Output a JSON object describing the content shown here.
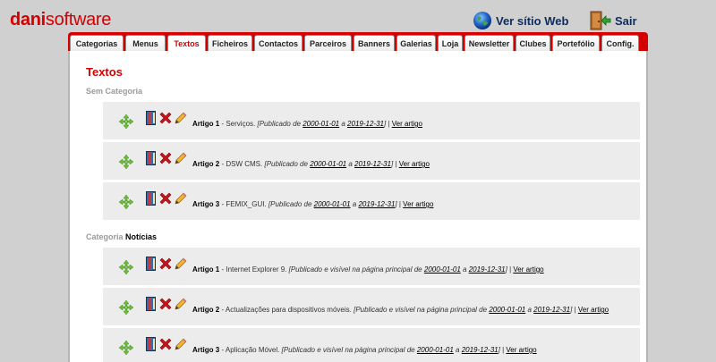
{
  "brand": {
    "part1": "dani",
    "part2": "software"
  },
  "header": {
    "web_label": "Ver sítio Web",
    "exit_label": "Sair"
  },
  "tabs": [
    {
      "label": "Categorias",
      "w": 60,
      "active": false
    },
    {
      "label": "Menus",
      "w": 45,
      "active": false
    },
    {
      "label": "Textos",
      "w": 43,
      "active": true
    },
    {
      "label": "Ficheiros",
      "w": 50,
      "active": false
    },
    {
      "label": "Contactos",
      "w": 54,
      "active": false
    },
    {
      "label": "Parceiros",
      "w": 53,
      "active": false
    },
    {
      "label": "Banners",
      "w": 46,
      "active": false
    },
    {
      "label": "Galerias",
      "w": 44,
      "active": false
    },
    {
      "label": "Loja",
      "w": 28,
      "active": false
    },
    {
      "label": "Newsletter",
      "w": 55,
      "active": false
    },
    {
      "label": "Clubes",
      "w": 39,
      "active": false
    },
    {
      "label": "Portefólio",
      "w": 53,
      "active": false
    },
    {
      "label": "Config.",
      "w": 42,
      "active": false
    }
  ],
  "page_title": "Textos",
  "sections": [
    {
      "label": "Sem Categoria",
      "category": "",
      "items": [
        {
          "title": "Artigo 1",
          "name": "Serviços.",
          "status_prefix": "[Publicado de",
          "from": "2000-01-01",
          "to_word": "a",
          "to": "2019-12-31",
          "close": "]",
          "view": "Ver artigo"
        },
        {
          "title": "Artigo 2",
          "name": "DSW CMS.",
          "status_prefix": "[Publicado de",
          "from": "2000-01-01",
          "to_word": "a",
          "to": "2019-12-31",
          "close": "]",
          "view": "Ver artigo"
        },
        {
          "title": "Artigo 3",
          "name": "FEMIX_GUI.",
          "status_prefix": "[Publicado de",
          "from": "2000-01-01",
          "to_word": "a",
          "to": "2019-12-31",
          "close": "]",
          "view": "Ver artigo"
        }
      ]
    },
    {
      "label": "Categoria",
      "category": "Notícias",
      "items": [
        {
          "title": "Artigo 1",
          "name": "Internet Explorer 9.",
          "status_prefix": "[Publicado e visível na página principal de",
          "from": "2000-01-01",
          "to_word": "a",
          "to": "2019-12-31",
          "close": "]",
          "view": "Ver artigo"
        },
        {
          "title": "Artigo 2",
          "name": "Actualizações para dispositivos móveis.",
          "status_prefix": "[Publicado e visível na página principal de",
          "from": "2000-01-01",
          "to_word": "a",
          "to": "2019-12-31",
          "close": "]",
          "view": "Ver artigo"
        },
        {
          "title": "Artigo 3",
          "name": "Aplicação Móvel.",
          "status_prefix": "[Publicado e visível na página principal de",
          "from": "2000-01-01",
          "to_word": "a",
          "to": "2019-12-31",
          "close": "]",
          "view": "Ver artigo"
        }
      ]
    }
  ],
  "icons": {
    "move": "move-arrows-icon",
    "book": "book-icon",
    "delete": "delete-x-icon",
    "edit": "pencil-edit-icon",
    "globe": "globe-icon",
    "exit": "exit-door-icon"
  },
  "colors": {
    "brand_red": "#d40000",
    "row_bg": "#ececec",
    "nav_text": "#0d2c5e"
  }
}
